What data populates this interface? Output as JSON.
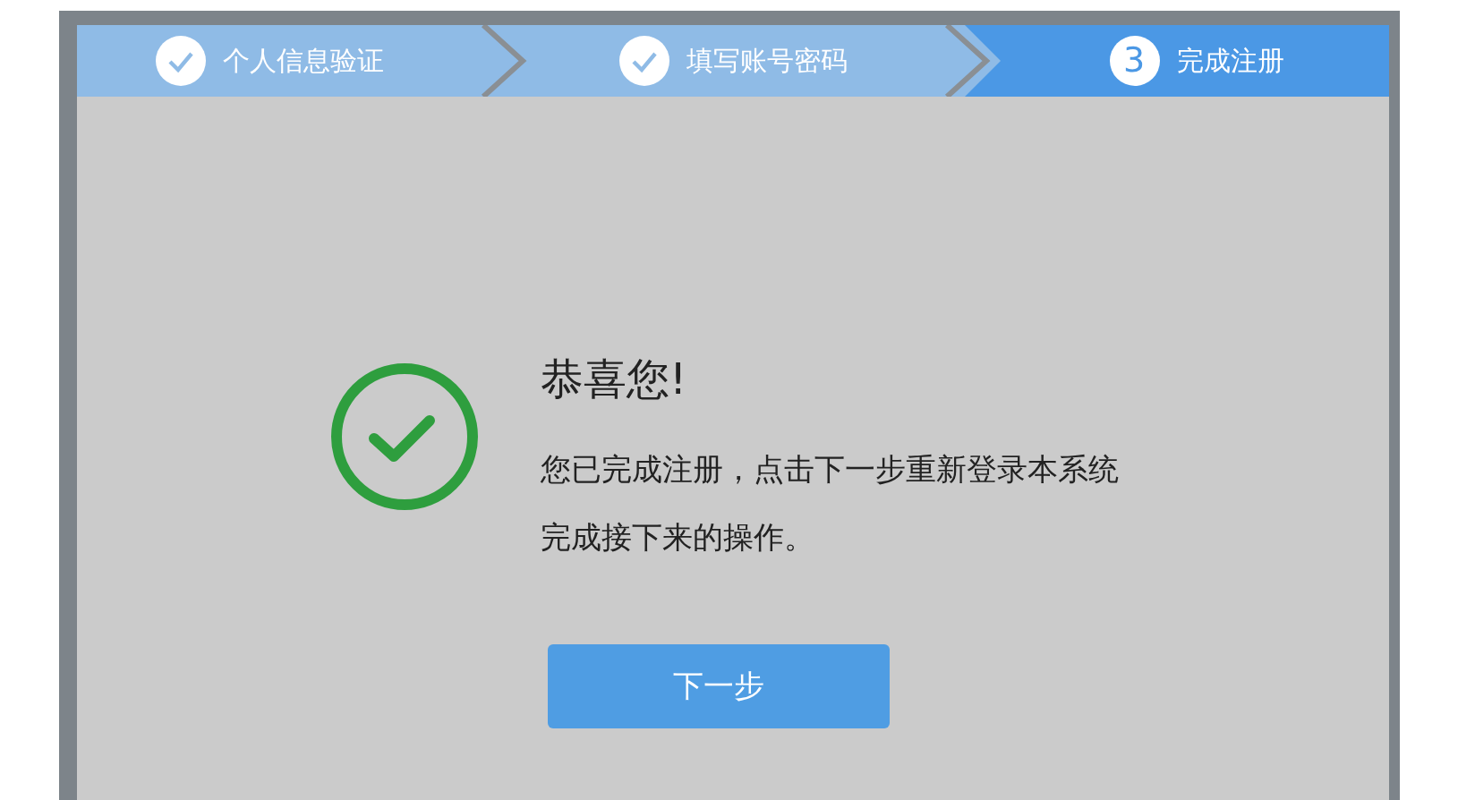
{
  "steps": [
    {
      "label": "个人信息验证",
      "done": true,
      "selected": false
    },
    {
      "label": "填写账号密码",
      "done": true,
      "selected": false
    },
    {
      "label": "完成注册",
      "number": "3",
      "done": false,
      "selected": true
    }
  ],
  "message": {
    "title": "恭喜您!",
    "lines": [
      "您已完成注册，点击下一步重新登录本系统",
      "完成接下来的操作。"
    ]
  },
  "button": {
    "label": "下一步"
  }
}
